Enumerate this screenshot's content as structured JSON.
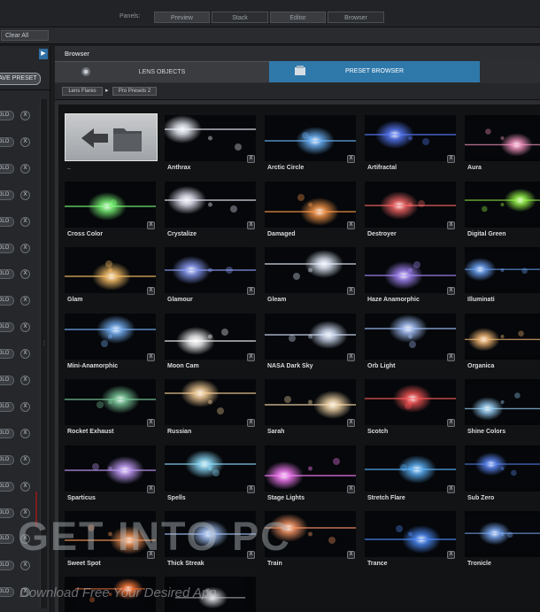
{
  "topbar": {
    "panels_label": "Panels:",
    "tabs": [
      {
        "label": "Preview"
      },
      {
        "label": "Stack"
      },
      {
        "label": "Editor"
      },
      {
        "label": "Browser"
      }
    ]
  },
  "toolbar": {
    "clear_all": "Clear All"
  },
  "left_panel": {
    "save_preset": "AVE PRESET",
    "solo_label": "OLO",
    "remove_label": "X",
    "grip": "⋮"
  },
  "browser": {
    "title": "Browser",
    "tabs": {
      "lens_objects": "LENS OBJECTS",
      "preset_browser": "PRESET BROWSER"
    },
    "breadcrumb": {
      "root": "Lens Flares",
      "sep": "▸",
      "current": "Pro Presets 2"
    },
    "back_label": "..",
    "remove_label": "X",
    "presets": [
      {
        "name": "Anthrax"
      },
      {
        "name": "Arctic Circle"
      },
      {
        "name": "Artifractal"
      },
      {
        "name": "Aura"
      },
      {
        "name": "Cross Color"
      },
      {
        "name": "Crystalize"
      },
      {
        "name": "Damaged"
      },
      {
        "name": "Destroyer"
      },
      {
        "name": "Digital Green"
      },
      {
        "name": "Glam"
      },
      {
        "name": "Glamour"
      },
      {
        "name": "Gleam"
      },
      {
        "name": "Haze Anamorphic"
      },
      {
        "name": "Illuminati"
      },
      {
        "name": "Mini-Anamorphic"
      },
      {
        "name": "Moon Cam"
      },
      {
        "name": "NASA Dark Sky"
      },
      {
        "name": "Orb Light"
      },
      {
        "name": "Organica"
      },
      {
        "name": "Rocket Exhaust"
      },
      {
        "name": "Russian"
      },
      {
        "name": "Sarah"
      },
      {
        "name": "Scotch"
      },
      {
        "name": "Shine Colors"
      },
      {
        "name": "Sparticus"
      },
      {
        "name": "Spells"
      },
      {
        "name": "Stage Lights"
      },
      {
        "name": "Stretch Flare"
      },
      {
        "name": "Sub Zero"
      },
      {
        "name": "Sweet Spot"
      },
      {
        "name": "Thick Streak"
      },
      {
        "name": "Train"
      },
      {
        "name": "Trance"
      },
      {
        "name": "Tronicle"
      },
      {
        "name": ""
      },
      {
        "name": ""
      }
    ],
    "flare_colors": [
      "#f2f4ff",
      "#6fb8ff",
      "#5a7dff",
      "#ff9ac8",
      "#7fff7a",
      "#f0f0ff",
      "#ff9a4a",
      "#ff6a6a",
      "#9cff4a",
      "#ffc46a",
      "#8fa2ff",
      "#e8f0ff",
      "#a98bff",
      "#6fa8ff",
      "#7ab8ff",
      "#ffffff",
      "#d9e6ff",
      "#a9c6ff",
      "#ffc07a",
      "#7fd0a0",
      "#ffd49a",
      "#ffe0b0",
      "#ff5a5a",
      "#9fd8ff",
      "#c8a0ff",
      "#8fe0ff",
      "#ff80ff",
      "#5fb6ff",
      "#5f8cff",
      "#ff9a5a",
      "#a8c8ff",
      "#ff9966",
      "#4f8fff",
      "#7fb0ff",
      "#ff7a3a",
      "#c9c9d0"
    ]
  },
  "watermark": {
    "title": "GET INTO PC",
    "subtitle": "Download Free Your Desired App"
  }
}
